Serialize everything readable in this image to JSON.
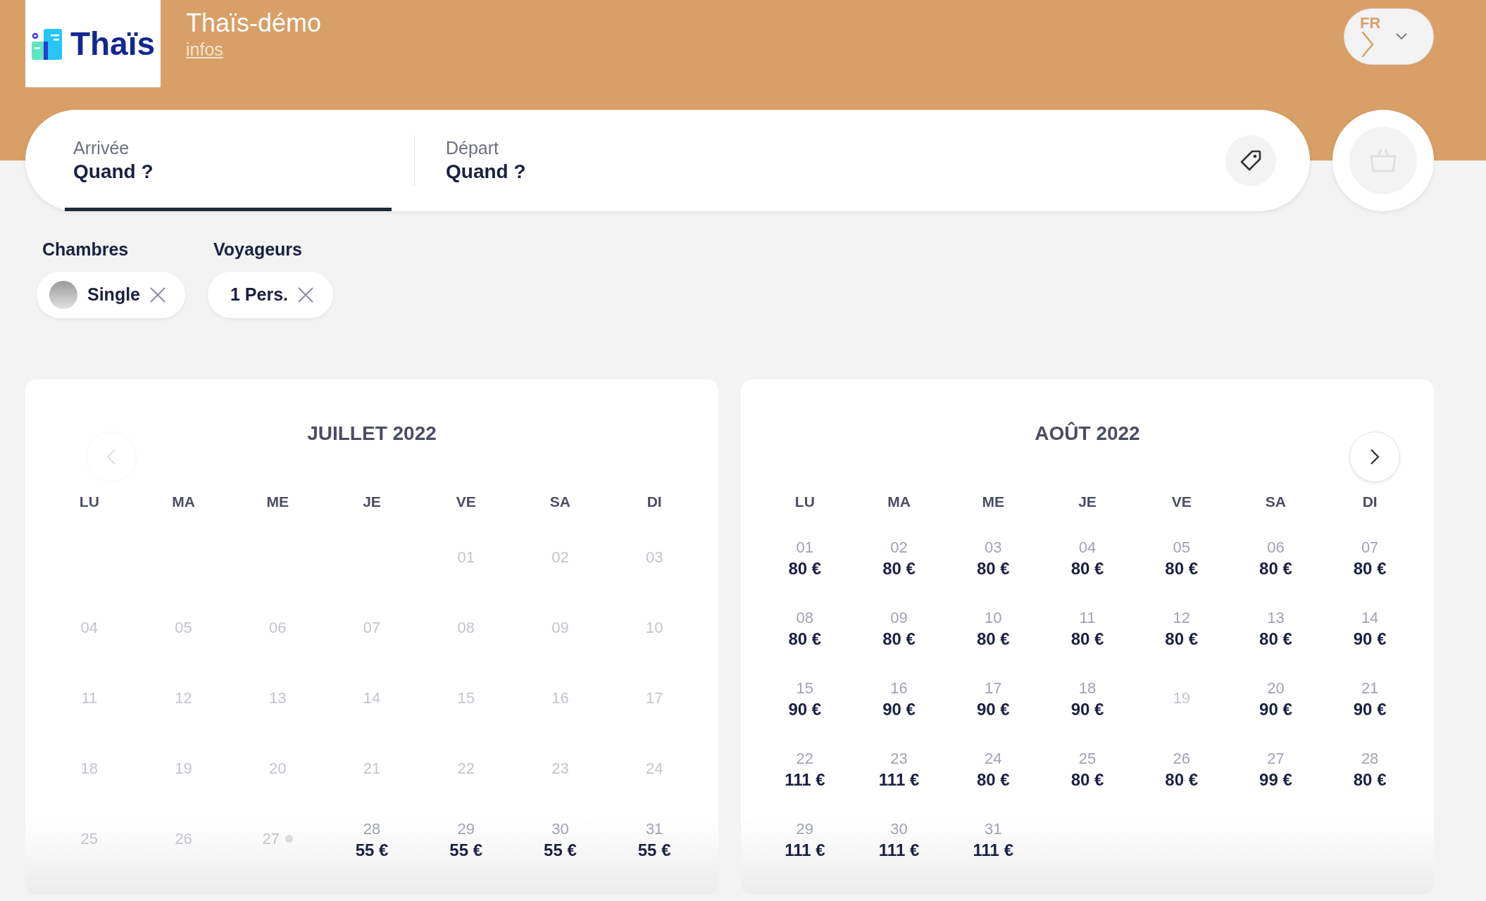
{
  "header": {
    "logo_text": "Thaïs",
    "title": "Thaïs-démo",
    "link": "infos",
    "language": {
      "code": "FR"
    }
  },
  "search": {
    "fields": [
      {
        "label": "Arrivée",
        "value": "Quand ?",
        "selected": true
      },
      {
        "label": "Départ",
        "value": "Quand ?",
        "selected": false
      }
    ]
  },
  "cart": {
    "disabled": true
  },
  "filters": [
    {
      "label": "Chambres",
      "chip": "Single",
      "kind": "photo"
    },
    {
      "label": "Voyageurs",
      "chip": "1 Pers.",
      "kind": "plain"
    }
  ],
  "calendars": [
    {
      "title": "JUILLET 2022",
      "nav": {
        "kind": "prev",
        "disabled": true
      },
      "weekdays": [
        "LU",
        "MA",
        "ME",
        "JE",
        "VE",
        "SA",
        "DI"
      ],
      "weeks": [
        {
          "right_aligned": true,
          "days": [
            {
              "day": "01",
              "available": false
            },
            {
              "day": "02",
              "available": false
            },
            {
              "day": "03",
              "available": false
            }
          ]
        },
        [
          {
            "day": "04",
            "available": false
          },
          {
            "day": "05",
            "available": false
          },
          {
            "day": "06",
            "available": false
          },
          {
            "day": "07",
            "available": false
          },
          {
            "day": "08",
            "available": false
          },
          {
            "day": "09",
            "available": false
          },
          {
            "day": "10",
            "available": false
          }
        ],
        [
          {
            "day": "11",
            "available": false
          },
          {
            "day": "12",
            "available": false
          },
          {
            "day": "13",
            "available": false
          },
          {
            "day": "14",
            "available": false
          },
          {
            "day": "15",
            "available": false
          },
          {
            "day": "16",
            "available": false
          },
          {
            "day": "17",
            "available": false
          }
        ],
        [
          {
            "day": "18",
            "available": false
          },
          {
            "day": "19",
            "available": false
          },
          {
            "day": "20",
            "available": false
          },
          {
            "day": "21",
            "available": false
          },
          {
            "day": "22",
            "available": false
          },
          {
            "day": "23",
            "available": false
          },
          {
            "day": "24",
            "available": false
          }
        ],
        [
          {
            "day": "25",
            "available": false
          },
          {
            "day": "26",
            "available": false
          },
          {
            "day": "27",
            "available": false,
            "today": true
          },
          {
            "day": "28",
            "available": true,
            "price": "55 €"
          },
          {
            "day": "29",
            "available": true,
            "price": "55 €"
          },
          {
            "day": "30",
            "available": true,
            "price": "55 €"
          },
          {
            "day": "31",
            "available": true,
            "price": "55 €"
          }
        ]
      ]
    },
    {
      "title": "AOÛT 2022",
      "nav": {
        "kind": "next",
        "disabled": false
      },
      "weekdays": [
        "LU",
        "MA",
        "ME",
        "JE",
        "VE",
        "SA",
        "DI"
      ],
      "weeks": [
        [
          {
            "day": "01",
            "available": true,
            "price": "80 €"
          },
          {
            "day": "02",
            "available": true,
            "price": "80 €"
          },
          {
            "day": "03",
            "available": true,
            "price": "80 €"
          },
          {
            "day": "04",
            "available": true,
            "price": "80 €"
          },
          {
            "day": "05",
            "available": true,
            "price": "80 €"
          },
          {
            "day": "06",
            "available": true,
            "price": "80 €"
          },
          {
            "day": "07",
            "available": true,
            "price": "80 €"
          }
        ],
        [
          {
            "day": "08",
            "available": true,
            "price": "80 €"
          },
          {
            "day": "09",
            "available": true,
            "price": "80 €"
          },
          {
            "day": "10",
            "available": true,
            "price": "80 €"
          },
          {
            "day": "11",
            "available": true,
            "price": "80 €"
          },
          {
            "day": "12",
            "available": true,
            "price": "80 €"
          },
          {
            "day": "13",
            "available": true,
            "price": "80 €"
          },
          {
            "day": "14",
            "available": true,
            "price": "90 €"
          }
        ],
        [
          {
            "day": "15",
            "available": true,
            "price": "90 €"
          },
          {
            "day": "16",
            "available": true,
            "price": "90 €"
          },
          {
            "day": "17",
            "available": true,
            "price": "90 €"
          },
          {
            "day": "18",
            "available": true,
            "price": "90 €"
          },
          {
            "day": "19",
            "available": false
          },
          {
            "day": "20",
            "available": true,
            "price": "90 €"
          },
          {
            "day": "21",
            "available": true,
            "price": "90 €"
          }
        ],
        [
          {
            "day": "22",
            "available": true,
            "price": "111 €"
          },
          {
            "day": "23",
            "available": true,
            "price": "111 €"
          },
          {
            "day": "24",
            "available": true,
            "price": "80 €"
          },
          {
            "day": "25",
            "available": true,
            "price": "80 €"
          },
          {
            "day": "26",
            "available": true,
            "price": "80 €"
          },
          {
            "day": "27",
            "available": true,
            "price": "99 €"
          },
          {
            "day": "28",
            "available": true,
            "price": "80 €"
          }
        ],
        [
          {
            "day": "29",
            "available": true,
            "price": "111 €"
          },
          {
            "day": "30",
            "available": true,
            "price": "111 €"
          },
          {
            "day": "31",
            "available": true,
            "price": "111 €"
          }
        ]
      ]
    }
  ]
}
